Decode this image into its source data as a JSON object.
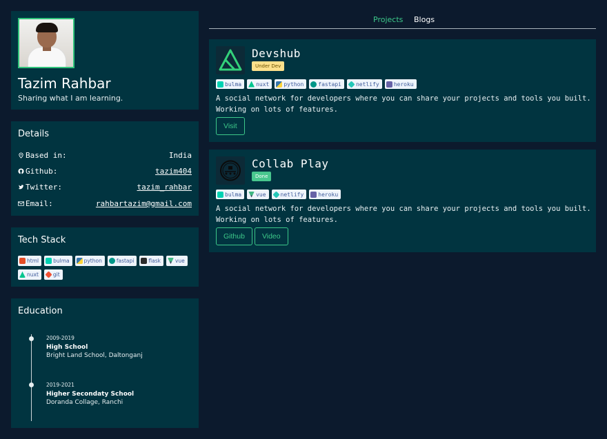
{
  "profile": {
    "name": "Tazim Rahbar",
    "tagline": "Sharing what I am learning."
  },
  "details": {
    "title": "Details",
    "rows": [
      {
        "label": "Based in:",
        "value": "India",
        "icon": "map-pin-icon"
      },
      {
        "label": "Github:",
        "value": "tazim404",
        "icon": "github-icon"
      },
      {
        "label": "Twitter:",
        "value": "tazim_rahbar",
        "icon": "twitter-icon"
      },
      {
        "label": "Email:",
        "value": "rahbartazim@gmail.com",
        "icon": "mail-icon"
      }
    ]
  },
  "tech": {
    "title": "Tech Stack",
    "items": [
      "html",
      "bulma",
      "python",
      "fastapi",
      "flask",
      "vue",
      "nuxt",
      "git"
    ]
  },
  "education": {
    "title": "Education",
    "events": [
      {
        "years": "2009-2019",
        "school": "High School",
        "place": "Bright Land School, Daltonganj"
      },
      {
        "years": "2019-2021",
        "school": "Higher Secondaty School",
        "place": "Doranda Collage, Ranchi"
      }
    ]
  },
  "tabs": [
    "Projects",
    "Blogs"
  ],
  "projects": [
    {
      "title": "Devshub",
      "status": "Under Dev",
      "tags": [
        "bulma",
        "nuxt",
        "python",
        "fastapi",
        "netlify",
        "heroku"
      ],
      "desc1": "A social network for developers where you can share your projects and tools you built.",
      "desc2": "Working on lots of features.",
      "buttons": [
        "Visit"
      ]
    },
    {
      "title": "Collab Play",
      "status": "Done",
      "tags": [
        "bulma",
        "vue",
        "netlify",
        "heroku"
      ],
      "desc1": "A social network for developers where you can share your projects and tools you built.",
      "desc2": "Working on lots of features.",
      "buttons": [
        "Github",
        "Video"
      ]
    }
  ],
  "colors": {
    "background": "#0c1a2d",
    "card": "#013440",
    "accent": "#3dc98a",
    "badge_warning": "#fde08b",
    "badge_done": "#48c78e"
  }
}
